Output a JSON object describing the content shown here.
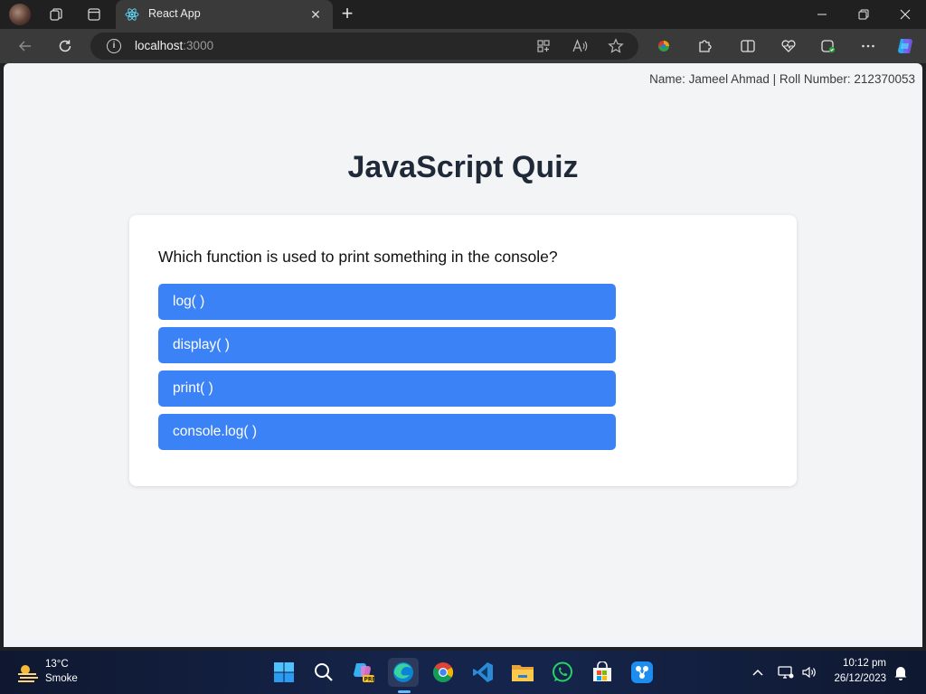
{
  "browser": {
    "tab": {
      "title": "React App",
      "favicon": "react-logo-icon"
    },
    "address": {
      "host": "localhost",
      "port": ":3000"
    },
    "colors": {
      "tabbar": "#202020",
      "toolbar": "#3a3a3a"
    }
  },
  "page": {
    "student_info": "Name: Jameel Ahmad | Roll Number: 212370053",
    "title": "JavaScript Quiz",
    "question": "Which function is used to print something in the console?",
    "options": [
      "log( )",
      "display( )",
      "print( )",
      "console.log( )"
    ],
    "colors": {
      "background": "#f3f4f6",
      "option": "#3b82f6",
      "title": "#1f2937"
    }
  },
  "taskbar": {
    "weather": {
      "temp": "13°C",
      "desc": "Smoke",
      "icon": "haze-icon"
    },
    "apps": [
      "start-icon",
      "search-icon",
      "copilot-icon",
      "edge-icon",
      "chrome-icon",
      "vscode-icon",
      "file-explorer-icon",
      "whatsapp-icon",
      "store-icon",
      "share-icon"
    ],
    "clock": {
      "time": "10:12 pm",
      "date": "26/12/2023"
    }
  }
}
